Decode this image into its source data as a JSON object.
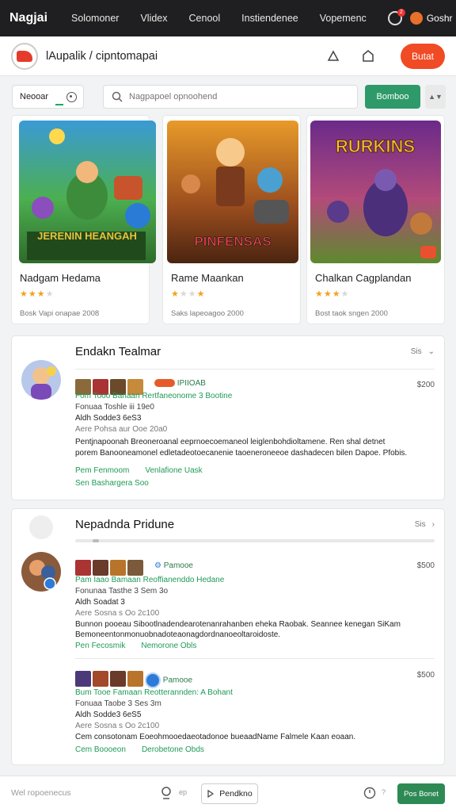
{
  "nav": {
    "brand": "Nagjai",
    "links": [
      "Solomoner",
      "Vlidex",
      "Cenool",
      "Instiendenee",
      "Vopemenc"
    ],
    "user": "Goshr",
    "notif_count": "2"
  },
  "subheader": {
    "breadcrumb": "lAupalik / cipntomapai",
    "cta": "Butat"
  },
  "filters": {
    "select_value": "Neooar",
    "search_placeholder": "Nagpapoel opnoohend",
    "go_button": "Bomboo",
    "sort_label": "▲▼"
  },
  "games": [
    {
      "title": "Nadgam Hedama",
      "rating": 3,
      "meta": "Bosk Vapi onapae 2008",
      "art_text": "JERENIN HEANGAH"
    },
    {
      "title": "Rame Maankan",
      "rating": 1,
      "meta": "Saks lapeoagoo 2000",
      "art_text": "PINFENSAS"
    },
    {
      "title": "Chalkan Cagplandan",
      "rating": 3,
      "meta": "Bost taok sngen 2000",
      "art_text": "RURKINS"
    }
  ],
  "panel1": {
    "title": "Endakn Tealmar",
    "see_label": "Sis",
    "item": {
      "tag": "IPIIOAB",
      "green_line": "Fom Tooo Banaan Rertfaneonome 3 Bootine",
      "line2": "Fonuaa Toshle iii 19e0",
      "line3": "Aldh Sodde3 6eS3",
      "line4": "Aere Pohsa aur Ooe 20a0",
      "desc1": "Pentjnapoonah Breoneroanal eeprnoecoemaneol leiglenbohdioltamene. Ren shal detnet",
      "desc2": "porem Banooneamonel edletadeotoecanenie taoeneroneeoe dashadecen bilen Dapoe. Pfobis.",
      "price": "$200",
      "link1": "Pem Fenmoom",
      "link2": "Venlafione Uask",
      "link3": "Sen Bashargera Soo"
    }
  },
  "panel2": {
    "title": "Nepadnda Pridune",
    "see_label": "Sis",
    "items": [
      {
        "tag": "Pamooe",
        "green_line": "Pam Iaao Bamaan Reoffianenddo Hedane",
        "line2": "Fonunaa Tasthe 3 Sem 3o",
        "line3": "Aldh Soadat 3",
        "line4": "Aere Sosna s Oo 2c100",
        "desc1": "Bunnon pooeau Sibootlnadendearotenanrahanben eheka Raobak. Seannee kenegan SiKam",
        "desc2": "Bemoneentonmonuobnadoteaonagdordnanoeoltaroidoste.",
        "price": "$500",
        "link1": "Pen Fecosmik",
        "link2": "Nemorone Obls"
      },
      {
        "tag": "Pamooe",
        "green_line": "Bum Tooe Famaan Reotterannden: A Bohant",
        "line2": "Fonuaa Taobe 3 Ses 3m",
        "line3": "Aldh Sodde3 6eS5",
        "line4": "Aere Sosna s Oo 2c100",
        "desc1": "Cem consotonam Eoeohmooedaeotadonoe bueaadName Falmele Kaan eoaan.",
        "desc2": "",
        "price": "$500",
        "link1": "Cem Boooeon",
        "link2": "Derobetone Obds"
      }
    ]
  },
  "footer": {
    "text": "Wel ropoenecus",
    "page_label": "Pendkno",
    "search_tag": "ep",
    "page_tag": "?",
    "action": "Pos Bonet"
  },
  "colors": {
    "accent_green": "#2e9a6a",
    "cta_orange": "#f04b24",
    "nav_bg": "#1f1f21"
  }
}
